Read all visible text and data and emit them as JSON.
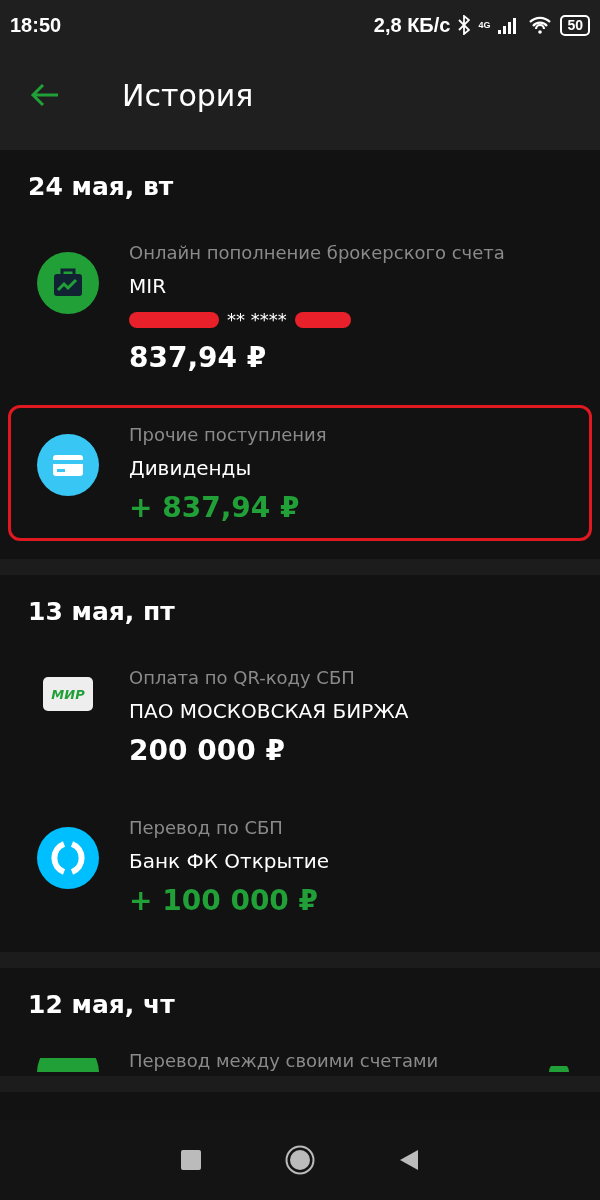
{
  "status_bar": {
    "time": "18:50",
    "speed": "2,8 КБ/с",
    "network": "4G",
    "battery": "50"
  },
  "header": {
    "title": "История"
  },
  "sections": [
    {
      "date": "24 мая, вт",
      "transactions": [
        {
          "kind": "briefcase",
          "category": "Онлайн пополнение брокерского счета",
          "name": "MIR",
          "card": "** ****",
          "redacted": true,
          "amount": "837,94 ₽",
          "positive": false,
          "highlighted": false
        },
        {
          "kind": "card",
          "category": "Прочие поступления",
          "name": "Дивиденды",
          "amount": "+ 837,94 ₽",
          "positive": true,
          "highlighted": true
        }
      ]
    },
    {
      "date": "13 мая, пт",
      "transactions": [
        {
          "kind": "mir",
          "icon_text": "МИР",
          "category": "Оплата по QR-коду СБП",
          "name": "ПАО МОСКОВСКАЯ БИРЖА",
          "amount": "200 000 ₽",
          "positive": false,
          "highlighted": false
        },
        {
          "kind": "ring",
          "category": "Перевод по СБП",
          "name": "Банк ФК Открытие",
          "amount": "+ 100 000 ₽",
          "positive": true,
          "highlighted": false
        }
      ]
    },
    {
      "date": "12 мая, чт",
      "transactions": [
        {
          "kind": "cut",
          "category": "Перевод между своими счетами",
          "highlighted": false
        }
      ]
    }
  ]
}
